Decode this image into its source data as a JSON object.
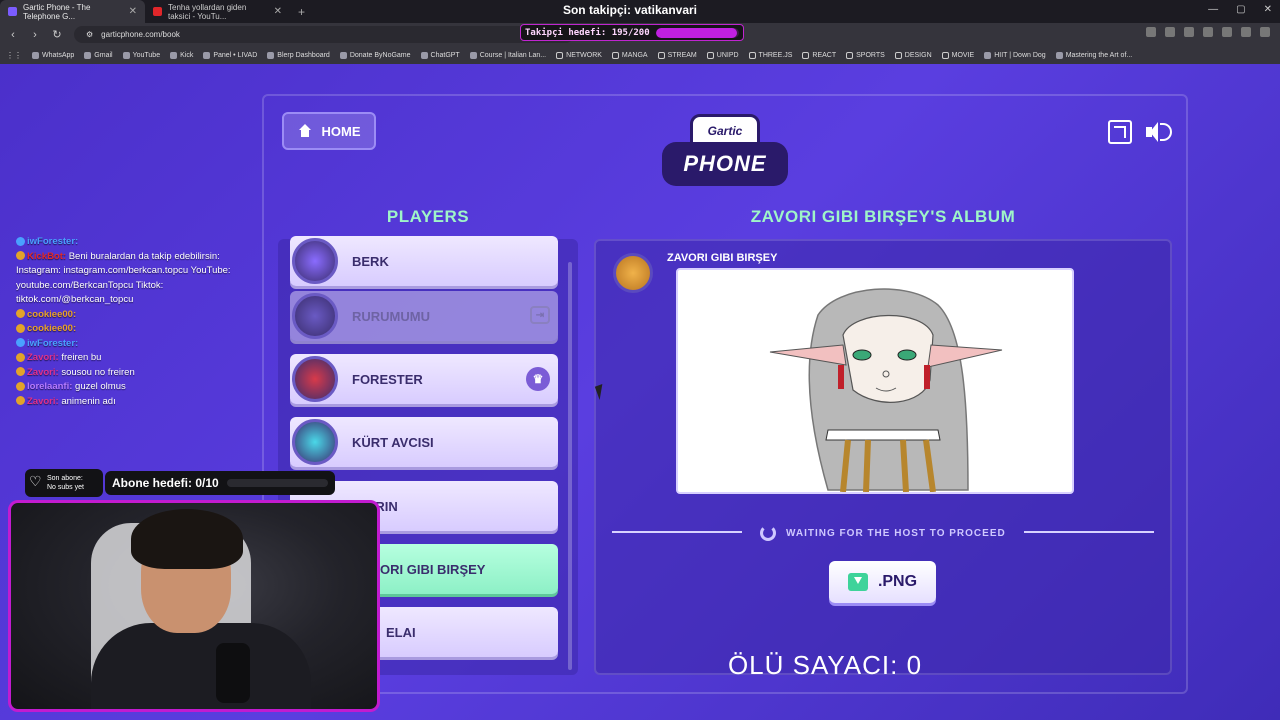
{
  "browser": {
    "tabs": [
      {
        "title": "Gartic Phone - The Telephone G...",
        "active": true
      },
      {
        "title": "Tenha yollardan giden taksici - YouTu...",
        "active": false
      }
    ],
    "url": "garticphone.com/book",
    "bookmarks": [
      "WhatsApp",
      "Gmail",
      "YouTube",
      "Kick",
      "Panel • LIVAD",
      "Blerp Dashboard",
      "Donate ByNoGame",
      "ChatGPT",
      "Course | Italian Lan...",
      "NETWORK",
      "MANGA",
      "STREAM",
      "UNIPD",
      "THREE.JS",
      "REACT",
      "SPORTS",
      "DESIGN",
      "MOVIE",
      "HIIT | Down Dog",
      "Mastering the Art of..."
    ]
  },
  "overlay": {
    "last_follower": "Son takipçi: vatikanvari",
    "follow_goal": "Takipçi hedefi: 195/200",
    "follow_progress": 0.975,
    "last_sub_label": "Son abone:",
    "last_sub_value": "No subs yet",
    "sub_goal": "Abone hedefi: 0/10"
  },
  "chat": [
    {
      "user": "iwForester:",
      "msg": "",
      "color": "#4aa0ff"
    },
    {
      "user": "KickBot:",
      "msg": "Beni buralardan da takip edebilirsin: Instagram: instagram.com/berkcan.topcu YouTube: youtube.com/BerkcanTopcu Tiktok: tiktok.com/@berkcan_topcu",
      "color": "#e02a2a"
    },
    {
      "user": "cookiee00:",
      "msg": "",
      "color": "#e8a12a"
    },
    {
      "user": "cookiee00:",
      "msg": "",
      "color": "#e8a12a"
    },
    {
      "user": "iwForester:",
      "msg": "",
      "color": "#4aa0ff"
    },
    {
      "user": "Zavori:",
      "msg": "freiren bu",
      "color": "#e0308a"
    },
    {
      "user": "Zavori:",
      "msg": "sousou no freiren",
      "color": "#e0308a"
    },
    {
      "user": "lorelaanfi:",
      "msg": "guzel olmus",
      "color": "#b57aff"
    },
    {
      "user": "Zavori:",
      "msg": "animenin adı",
      "color": "#e0308a"
    }
  ],
  "game": {
    "home_label": "HOME",
    "logo_top": "Gartic",
    "logo_bottom": "PHONE",
    "players_title": "PLAYERS",
    "album_title": "ZAVORI GIBI BIRŞEY'S ALBUM",
    "players": [
      {
        "name": "BERK",
        "style": "normal",
        "avatar_color": "#8a6cff",
        "badge": ""
      },
      {
        "name": "RURUMUMU",
        "style": "gray",
        "avatar_color": "#6a5ac4",
        "badge": "exit"
      },
      {
        "name": "FORESTER",
        "style": "normal",
        "avatar_color": "#d83a4a",
        "badge": "crown"
      },
      {
        "name": "KÜRT AVCISI",
        "style": "normal",
        "avatar_color": "#4ad8e8",
        "badge": ""
      },
      {
        "name": "URIN",
        "style": "normal",
        "avatar_color": "#7b5cd6",
        "badge": ""
      },
      {
        "name": "ORI GIBI BIRŞEY",
        "style": "green",
        "avatar_color": "#f0b24a",
        "badge": ""
      },
      {
        "name": "ELAI",
        "style": "normal",
        "avatar_color": "#7b5cd6",
        "badge": ""
      }
    ],
    "album_author": "ZAVORI GIBI BIRŞEY",
    "wait_text": "WAITING FOR THE HOST TO PROCEED",
    "png_label": ".PNG",
    "death_counter": "ÖLÜ SAYACI: 0"
  }
}
